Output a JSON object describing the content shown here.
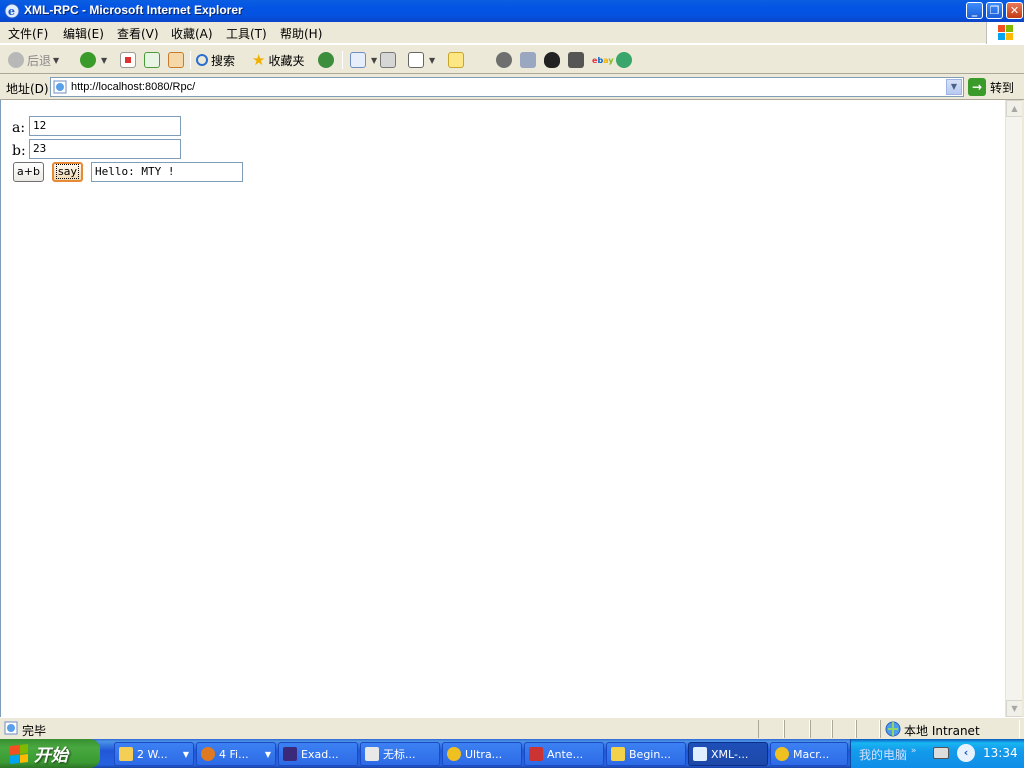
{
  "window": {
    "title": "XML-RPC - Microsoft Internet Explorer",
    "minimize_glyph": "_",
    "restore_glyph": "❐",
    "close_glyph": "✕"
  },
  "menu": {
    "items": [
      "文件(F)",
      "编辑(E)",
      "查看(V)",
      "收藏(A)",
      "工具(T)",
      "帮助(H)"
    ]
  },
  "toolbar": {
    "back_label": "后退",
    "search_label": "搜索",
    "favorites_label": "收藏夹"
  },
  "address": {
    "label": "地址(D)",
    "url": "http://localhost:8080/Rpc/",
    "go_label": "转到"
  },
  "form": {
    "a_label": "a:",
    "a_value": "12",
    "b_label": "b:",
    "b_value": "23",
    "add_button": "a+b",
    "say_button": "say",
    "result_value": "Hello: MTY !"
  },
  "status": {
    "text": "完毕",
    "zone": "本地 Intranet"
  },
  "taskbar": {
    "start_label": "开始",
    "tasks": [
      "2 W...",
      "4 Fi...",
      "Exad...",
      "无标...",
      "Ultra...",
      "Ante...",
      "Begin...",
      "XML-...",
      "Macr..."
    ],
    "tray_label": "我的电脑",
    "clock": "13:34"
  },
  "colors": {
    "titlebar": "#0454e4",
    "chrome": "#ece9d8",
    "taskbar": "#2157d7",
    "start_button": "#3b9b33",
    "focus_ring": "#e78a35"
  }
}
